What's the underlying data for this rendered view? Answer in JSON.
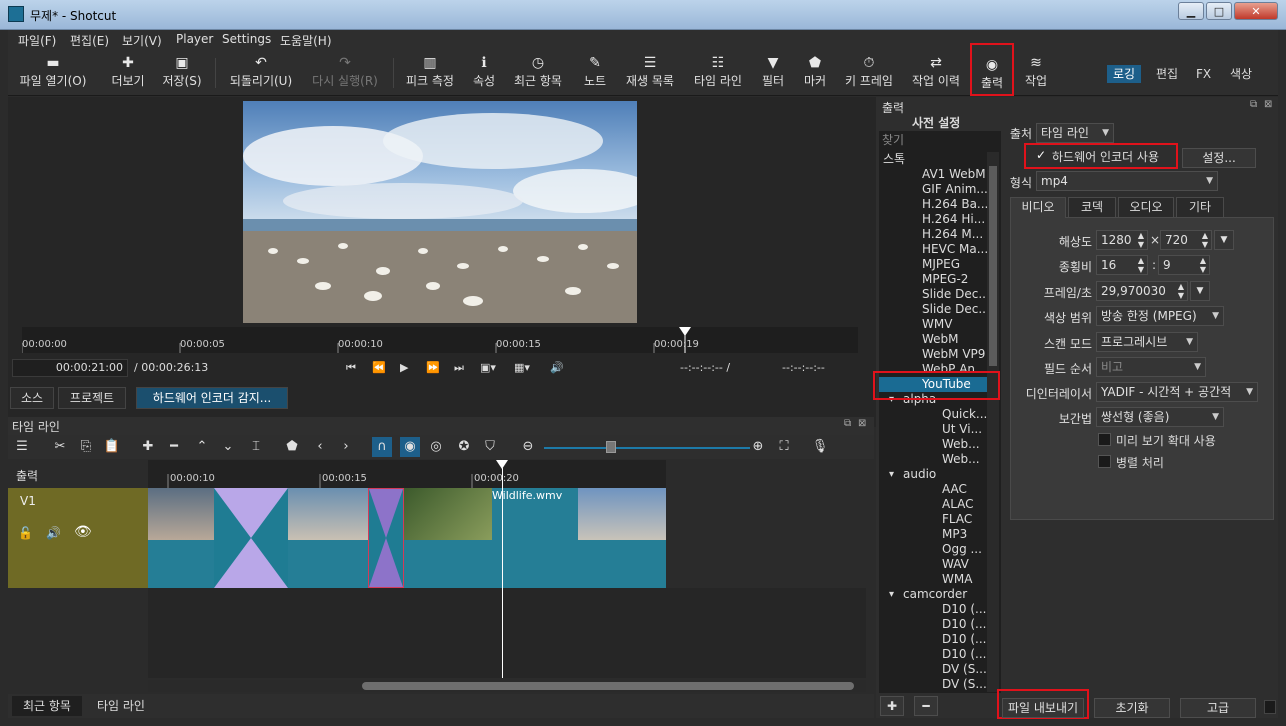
{
  "window": {
    "title": "무제* - Shotcut"
  },
  "menu": [
    "파일(F)",
    "편집(E)",
    "보기(V)",
    "Player",
    "Settings",
    "도움말(H)"
  ],
  "toolbar": {
    "open": "파일 열기(O)",
    "more": "더보기",
    "save": "저장(S)",
    "undo": "되돌리기(U)",
    "redo": "다시 실행(R)",
    "peak": "피크 측정",
    "properties": "속성",
    "recent": "최근 항목",
    "notes": "노트",
    "playlist": "재생 목록",
    "timeline": "타임 라인",
    "filters": "필터",
    "markers": "마커",
    "keyframes": "키 프레임",
    "history": "작업 이력",
    "export": "출력",
    "jobs": "작업",
    "modes": [
      "로깅",
      "편집",
      "FX",
      "색상"
    ]
  },
  "viewer": {
    "ruler_ticks": [
      "00:00:00",
      "00:00:05",
      "00:00:10",
      "00:00:15",
      "00:00:19"
    ],
    "position": "00:00:21:00",
    "duration": "/ 00:00:26:13",
    "in_point": "--:--:--:-- /",
    "out_point": "--:--:--:--",
    "tabs": [
      "소스",
      "프로젝트",
      "하드웨어 인코더 감지..."
    ]
  },
  "timeline": {
    "title": "타임 라인",
    "output_label": "출력",
    "track_name": "V1",
    "ruler_ticks": [
      "00:00:10",
      "00:00:15",
      "00:00:20"
    ],
    "clip_label": "Wildlife.wmv",
    "bottom_tabs": [
      "최근 항목",
      "타임 라인"
    ]
  },
  "export": {
    "dock_title": "출력",
    "presets_title": "사전 설정",
    "search_placeholder": "찾기",
    "presets": [
      {
        "text": "스톡",
        "level": 0,
        "expander": true
      },
      {
        "text": "AV1 WebM",
        "level": 1
      },
      {
        "text": "GIF Anim...",
        "level": 1
      },
      {
        "text": "H.264 Ba...",
        "level": 1
      },
      {
        "text": "H.264 Hi...",
        "level": 1
      },
      {
        "text": "H.264 M...",
        "level": 1
      },
      {
        "text": "HEVC Ma...",
        "level": 1
      },
      {
        "text": "MJPEG",
        "level": 1
      },
      {
        "text": "MPEG-2",
        "level": 1
      },
      {
        "text": "Slide Dec...",
        "level": 1
      },
      {
        "text": "Slide Dec...",
        "level": 1
      },
      {
        "text": "WMV",
        "level": 1
      },
      {
        "text": "WebM",
        "level": 1
      },
      {
        "text": "WebM VP9",
        "level": 1
      },
      {
        "text": "WebP An...",
        "level": 1
      },
      {
        "text": "YouTube",
        "level": 1,
        "selected": true
      },
      {
        "text": "alpha",
        "level": 1,
        "expander": true
      },
      {
        "text": "Quick...",
        "level": 2
      },
      {
        "text": "Ut Vi...",
        "level": 2
      },
      {
        "text": "Web...",
        "level": 2
      },
      {
        "text": "Web...",
        "level": 2
      },
      {
        "text": "audio",
        "level": 1,
        "expander": true
      },
      {
        "text": "AAC",
        "level": 2
      },
      {
        "text": "ALAC",
        "level": 2
      },
      {
        "text": "FLAC",
        "level": 2
      },
      {
        "text": "MP3",
        "level": 2
      },
      {
        "text": "Ogg ...",
        "level": 2
      },
      {
        "text": "WAV",
        "level": 2
      },
      {
        "text": "WMA",
        "level": 2
      },
      {
        "text": "camcorder",
        "level": 1,
        "expander": true
      },
      {
        "text": "D10 (...",
        "level": 2
      },
      {
        "text": "D10 (...",
        "level": 2
      },
      {
        "text": "D10 (...",
        "level": 2
      },
      {
        "text": "D10 (...",
        "level": 2
      },
      {
        "text": "DV (S...",
        "level": 2
      },
      {
        "text": "DV (S...",
        "level": 2
      }
    ],
    "source_label": "출처",
    "source_value": "타임 라인",
    "hw_encoder_label": "하드웨어 인코더 사용",
    "settings_button": "설정...",
    "format_label": "형식",
    "format_value": "mp4",
    "tabs": [
      "비디오",
      "코덱",
      "오디오",
      "기타"
    ],
    "resolution_label": "해상도",
    "width": "1280",
    "height": "720",
    "aspect_label": "종횡비",
    "aspect_w": "16",
    "aspect_h": "9",
    "fps_label": "프레임/초",
    "fps_value": "29,970030",
    "color_range_label": "색상 범위",
    "color_range_value": "방송 한정 (MPEG)",
    "scan_label": "스캔 모드",
    "scan_value": "프로그레시브",
    "field_label": "필드 순서",
    "field_value": "비고",
    "deinterlace_label": "디인터레이서",
    "deinterlace_value": "YADIF - 시간적 + 공간적",
    "interp_label": "보간법",
    "interp_value": "쌍선형 (좋음)",
    "preview_scale_label": "미리 보기 확대 사용",
    "parallel_label": "병렬 처리",
    "export_file_button": "파일 내보내기",
    "reset_button": "초기화",
    "advanced_button": "고급",
    "times_sign": "×",
    "colon_sign": ":"
  },
  "colors": {
    "accent": "#1a6b93",
    "highlight_red": "#e0121b",
    "track": "#6f6a25"
  }
}
